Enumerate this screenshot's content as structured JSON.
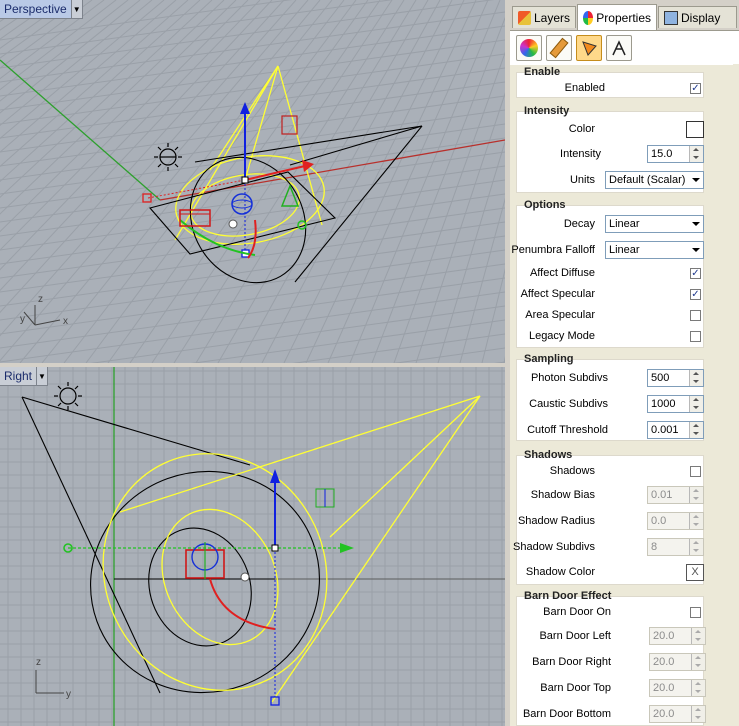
{
  "viewports": {
    "top": {
      "label": "Perspective",
      "axis_x": "x",
      "axis_z": "z",
      "axis_y": "y"
    },
    "bottom": {
      "label": "Right",
      "axis_z": "z",
      "axis_y": "y"
    }
  },
  "panel": {
    "tabs": [
      {
        "label": "Layers",
        "icon": "layers-icon"
      },
      {
        "label": "Properties",
        "icon": "properties-icon"
      },
      {
        "label": "Display",
        "icon": "display-icon"
      }
    ],
    "toolbar_icons": [
      "color-wheel-icon",
      "material-icon",
      "light-icon",
      "render-icon"
    ],
    "enable": {
      "title": "Enable",
      "enabled_label": "Enabled",
      "enabled_checked": true
    },
    "intensity": {
      "title": "Intensity",
      "color_label": "Color",
      "color_value": "#ffffff",
      "intensity_label": "Intensity",
      "intensity_value": "15.0",
      "units_label": "Units",
      "units_value": "Default (Scalar)"
    },
    "options": {
      "title": "Options",
      "decay_label": "Decay",
      "decay_value": "Linear",
      "penumbra_label": "Penumbra Falloff",
      "penumbra_value": "Linear",
      "affect_diffuse_label": "Affect Diffuse",
      "affect_diffuse_checked": true,
      "affect_specular_label": "Affect Specular",
      "affect_specular_checked": true,
      "area_specular_label": "Area Specular",
      "area_specular_checked": false,
      "legacy_mode_label": "Legacy Mode",
      "legacy_mode_checked": false
    },
    "sampling": {
      "title": "Sampling",
      "photon_label": "Photon Subdivs",
      "photon_value": "500",
      "caustic_label": "Caustic Subdivs",
      "caustic_value": "1000",
      "cutoff_label": "Cutoff Threshold",
      "cutoff_value": "0.001"
    },
    "shadows": {
      "title": "Shadows",
      "shadows_label": "Shadows",
      "shadows_checked": false,
      "bias_label": "Shadow Bias",
      "bias_value": "0.01",
      "radius_label": "Shadow Radius",
      "radius_value": "0.0",
      "subdivs_label": "Shadow Subdivs",
      "subdivs_value": "8",
      "color_label": "Shadow Color",
      "color_text": "X"
    },
    "barn_door": {
      "title": "Barn Door Effect",
      "on_label": "Barn Door On",
      "on_checked": false,
      "left_label": "Barn Door Left",
      "left_value": "20.0",
      "right_label": "Barn Door Right",
      "right_value": "20.0",
      "top_label": "Barn Door Top",
      "top_value": "20.0",
      "bottom_label": "Barn Door Bottom",
      "bottom_value": "20.0"
    }
  },
  "colors": {
    "viewport_bg": "#aab0b8",
    "grid_line": "#9aa0a8",
    "yellow": "#ffff33",
    "red_axis": "#b8302c",
    "green_axis": "#2ea02e",
    "blue_gizmo": "#1020e0"
  }
}
